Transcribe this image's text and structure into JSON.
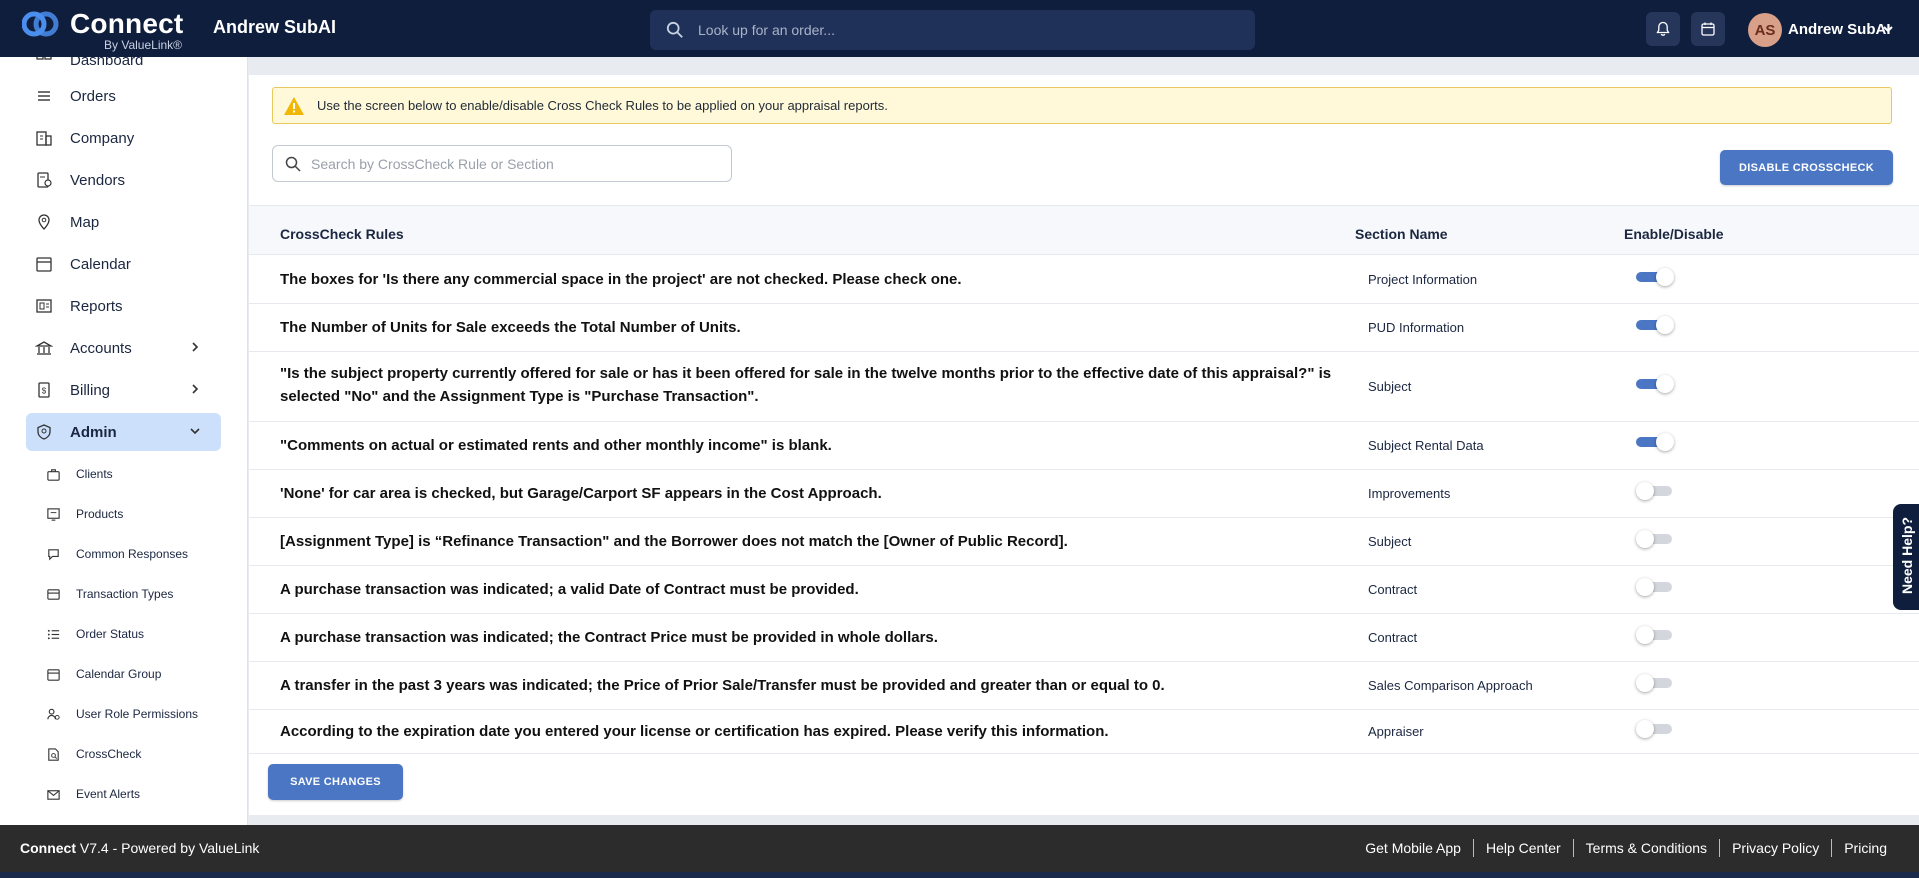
{
  "header": {
    "logo_text": "Connect",
    "logo_sub": "By ValueLink®",
    "user_title": "Andrew SubAI",
    "search_placeholder": "Look up for an order...",
    "avatar_initials": "AS",
    "account_name": "Andrew SubAI"
  },
  "sidebar": {
    "items": [
      {
        "label": "Dashboard",
        "icon": "dashboard-icon"
      },
      {
        "label": "Orders",
        "icon": "list-icon"
      },
      {
        "label": "Company",
        "icon": "building-icon"
      },
      {
        "label": "Vendors",
        "icon": "vendor-icon"
      },
      {
        "label": "Map",
        "icon": "map-pin-icon"
      },
      {
        "label": "Calendar",
        "icon": "calendar-icon"
      },
      {
        "label": "Reports",
        "icon": "reports-icon"
      },
      {
        "label": "Accounts",
        "icon": "bank-icon"
      },
      {
        "label": "Billing",
        "icon": "billing-icon"
      },
      {
        "label": "Admin",
        "icon": "shield-icon"
      }
    ],
    "admin_sub": [
      {
        "label": "Clients",
        "icon": "briefcase-icon"
      },
      {
        "label": "Products",
        "icon": "product-icon"
      },
      {
        "label": "Common Responses",
        "icon": "chat-icon"
      },
      {
        "label": "Transaction Types",
        "icon": "card-icon"
      },
      {
        "label": "Order Status",
        "icon": "list-status-icon"
      },
      {
        "label": "Calendar Group",
        "icon": "calendar-group-icon"
      },
      {
        "label": "User Role Permissions",
        "icon": "user-role-icon"
      },
      {
        "label": "CrossCheck",
        "icon": "crosscheck-icon"
      },
      {
        "label": "Event Alerts",
        "icon": "mail-alert-icon"
      }
    ]
  },
  "main": {
    "alert": "Use the screen below to enable/disable Cross Check Rules to be applied on your appraisal reports.",
    "search_placeholder": "Search by CrossCheck Rule or Section",
    "disable_button": "DISABLE CROSSCHECK",
    "columns": {
      "rule": "CrossCheck Rules",
      "section": "Section Name",
      "toggle": "Enable/Disable"
    },
    "rows": [
      {
        "rule": "The boxes for 'Is there any commercial space in the project' are not checked. Please check one.",
        "section": "Project Information",
        "enabled": true
      },
      {
        "rule": "The Number of Units for Sale exceeds the Total Number of Units.",
        "section": "PUD Information",
        "enabled": true
      },
      {
        "rule": "\"Is the subject property currently offered for sale or has it been offered for sale in the twelve months prior to the effective date of this appraisal?\" is selected \"No\" and the Assignment Type is \"Purchase Transaction\".",
        "section": "Subject",
        "enabled": true
      },
      {
        "rule": "\"Comments on actual or estimated rents and other monthly income\" is blank.",
        "section": "Subject Rental Data",
        "enabled": true
      },
      {
        "rule": "'None' for car area is checked, but Garage/Carport SF appears in the Cost Approach.",
        "section": "Improvements",
        "enabled": false
      },
      {
        "rule": "[Assignment Type] is “Refinance Transaction\" and the Borrower does not match the [Owner of Public Record].",
        "section": "Subject",
        "enabled": false
      },
      {
        "rule": "A purchase transaction was indicated; a valid Date of Contract must be provided.",
        "section": "Contract",
        "enabled": false
      },
      {
        "rule": "A purchase transaction was indicated; the Contract Price must be provided in whole dollars.",
        "section": "Contract",
        "enabled": false
      },
      {
        "rule": "A transfer in the past 3 years was indicated; the Price of Prior Sale/Transfer must be provided and greater than or equal to 0.",
        "section": "Sales Comparison Approach",
        "enabled": false
      },
      {
        "rule": "According to the expiration date you entered your license or certification has expired. Please verify this information.",
        "section": "Appraiser",
        "enabled": false
      }
    ],
    "save_button": "SAVE CHANGES"
  },
  "need_help": "Need Help?",
  "footer": {
    "brand": "Connect",
    "version": "V7.4 - Powered by ValueLink",
    "links": [
      "Get Mobile App",
      "Help Center",
      "Terms & Conditions",
      "Privacy Policy",
      "Pricing"
    ]
  },
  "colors": {
    "header_bg": "#0f1e3d",
    "accent": "#4a76c3",
    "active_nav": "#cde0fb",
    "alert_bg": "#fff9d9"
  }
}
